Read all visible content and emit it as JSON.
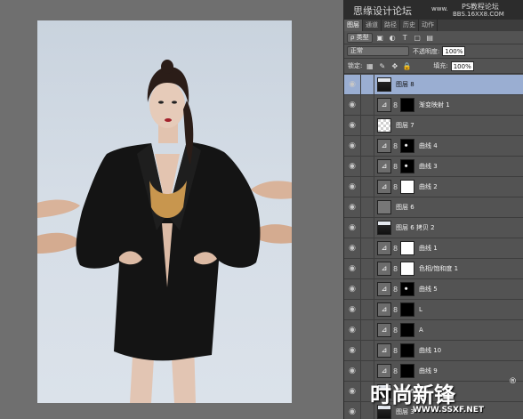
{
  "canvas": {
    "bg_color": "#6f6f6f"
  },
  "panel": {
    "watermark_left": "思缘设计论坛",
    "watermark_url": "www.",
    "watermark_right": "PS教程论坛",
    "watermark_sub": "BBS.16XX8.COM",
    "tabs": [
      "图层",
      "通道",
      "路径",
      "历史",
      "动作"
    ],
    "filter_label": "ρ 类型",
    "blend_mode": "正常",
    "opacity_label": "不透明度:",
    "opacity_value": "100%",
    "lock_label": "锁定:",
    "fill_label": "填充:",
    "fill_value": "100%"
  },
  "layers": [
    {
      "name": "图层 8",
      "thumb": "photo",
      "selected": true,
      "mask": null,
      "linked": false
    },
    {
      "name": "渐变映射 1",
      "thumb": "adj",
      "mask": "black",
      "linked": true
    },
    {
      "name": "图层 7",
      "thumb": "checker",
      "mask": null,
      "linked": false
    },
    {
      "name": "曲线 4",
      "thumb": "adj",
      "mask": "blackdot",
      "linked": true
    },
    {
      "name": "曲线 3",
      "thumb": "adj",
      "mask": "blackdot",
      "linked": true
    },
    {
      "name": "曲线 2",
      "thumb": "adj",
      "mask": "white",
      "linked": true
    },
    {
      "name": "图层 6",
      "thumb": "grey",
      "mask": null,
      "linked": false
    },
    {
      "name": "图层 6 拷贝 2",
      "thumb": "photo",
      "mask": null,
      "linked": false
    },
    {
      "name": "曲线 1",
      "thumb": "adj",
      "mask": "white",
      "linked": true
    },
    {
      "name": "色相/饱和度 1",
      "thumb": "adj",
      "mask": "white",
      "linked": true
    },
    {
      "name": "曲线 5",
      "thumb": "adj",
      "mask": "blackdot",
      "linked": true
    },
    {
      "name": "L",
      "thumb": "adj",
      "mask": "black",
      "linked": true
    },
    {
      "name": "A",
      "thumb": "adj",
      "mask": "black",
      "linked": true
    },
    {
      "name": "曲线 10",
      "thumb": "adj",
      "mask": "black",
      "linked": true
    },
    {
      "name": "曲线 9",
      "thumb": "adj",
      "mask": "black",
      "linked": true
    },
    {
      "name": "图层 6 拷贝",
      "thumb": "photo",
      "mask": null,
      "linked": false
    },
    {
      "name": "图层 3",
      "thumb": "photo",
      "mask": null,
      "linked": false
    }
  ],
  "brand": {
    "name": "时尚新锋",
    "url": "WWW.SSXF.NET",
    "mark": "®"
  }
}
